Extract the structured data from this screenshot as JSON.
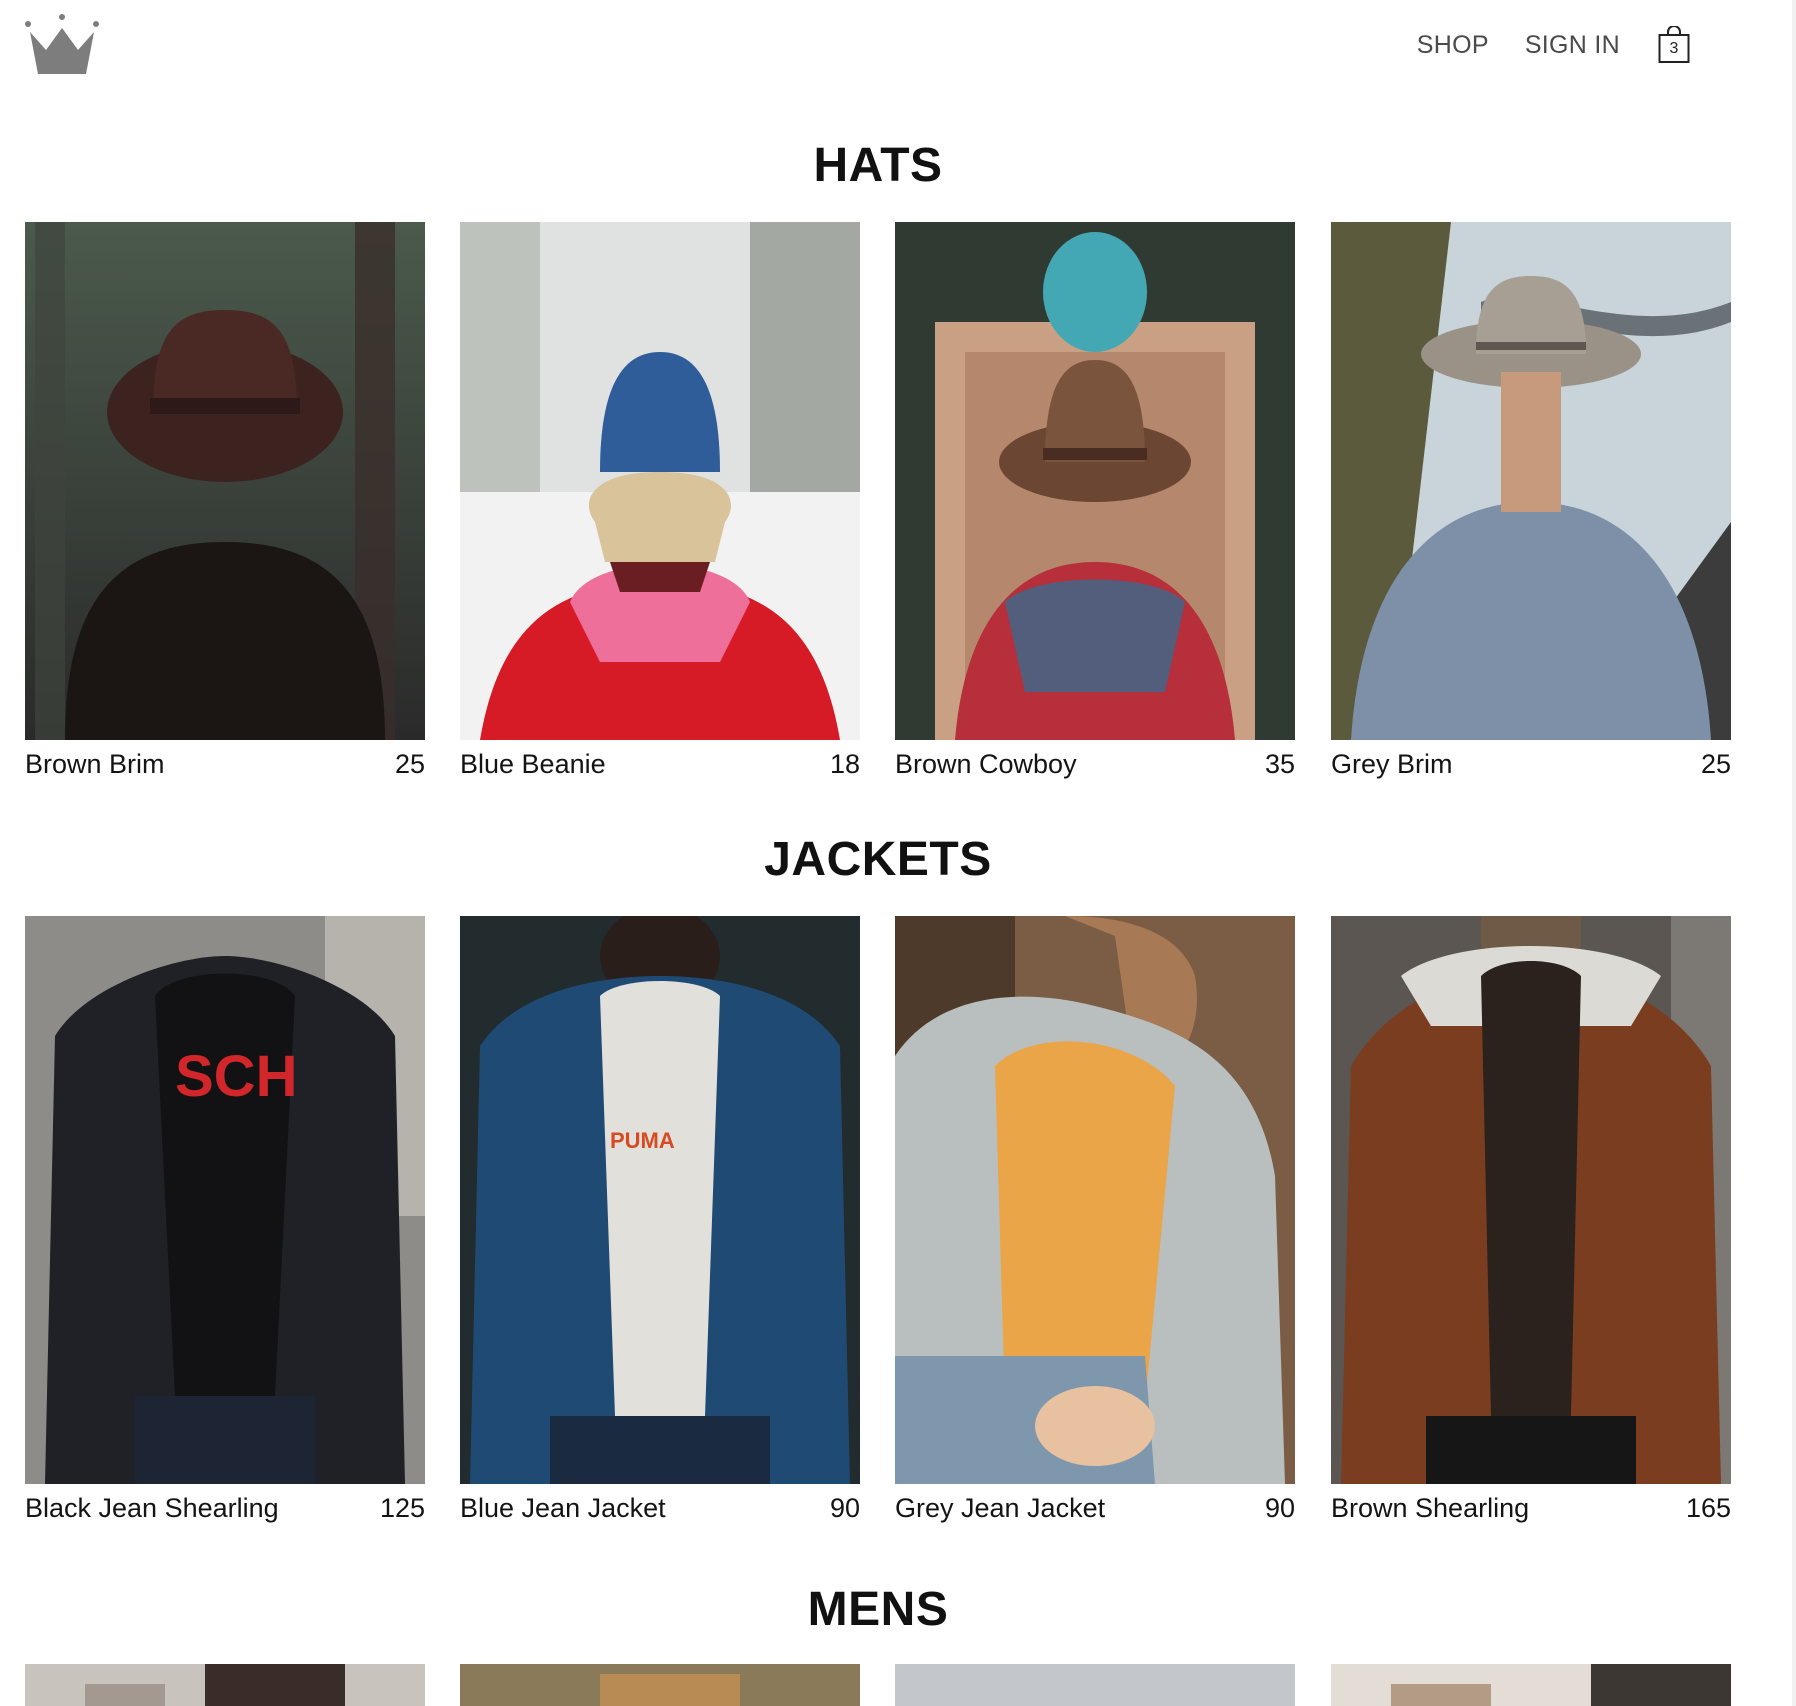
{
  "header": {
    "logo_icon": "crown-icon",
    "nav": {
      "shop": "SHOP",
      "sign_in": "SIGN IN"
    },
    "cart": {
      "icon": "shopping-bag-icon",
      "count": "3"
    }
  },
  "sections": [
    {
      "title": "HATS",
      "items": [
        {
          "name": "Brown Brim",
          "price": "25"
        },
        {
          "name": "Blue Beanie",
          "price": "18"
        },
        {
          "name": "Brown Cowboy",
          "price": "35"
        },
        {
          "name": "Grey Brim",
          "price": "25"
        }
      ]
    },
    {
      "title": "JACKETS",
      "items": [
        {
          "name": "Black Jean Shearling",
          "price": "125"
        },
        {
          "name": "Blue Jean Jacket",
          "price": "90"
        },
        {
          "name": "Grey Jean Jacket",
          "price": "90"
        },
        {
          "name": "Brown Shearling",
          "price": "165"
        }
      ]
    },
    {
      "title": "MENS",
      "items": []
    }
  ],
  "colors": {
    "nav_text": "#4a4a4a",
    "title_text": "#111111",
    "logo": "#7d7d7d"
  }
}
